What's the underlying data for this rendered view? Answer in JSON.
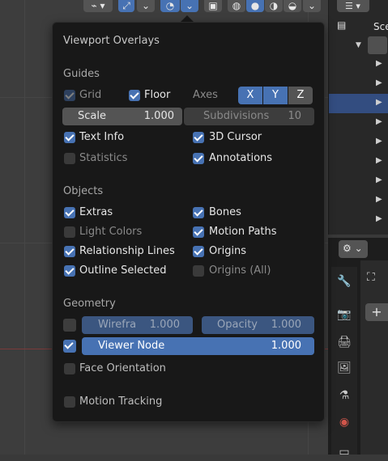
{
  "popover": {
    "title": "Viewport Overlays",
    "guides": {
      "heading": "Guides",
      "grid": {
        "label": "Grid",
        "checked": true,
        "enabled": false
      },
      "floor": {
        "label": "Floor",
        "checked": true
      },
      "axes_label": "Axes",
      "axes": [
        "X",
        "Y",
        "Z"
      ],
      "scale": {
        "label": "Scale",
        "value": "1.000"
      },
      "subdivisions": {
        "label": "Subdivisions",
        "value": "10"
      },
      "text_info": {
        "label": "Text Info",
        "checked": true
      },
      "cursor_3d": {
        "label": "3D Cursor",
        "checked": true
      },
      "statistics": {
        "label": "Statistics",
        "checked": false
      },
      "annotations": {
        "label": "Annotations",
        "checked": true
      }
    },
    "objects": {
      "heading": "Objects",
      "extras": {
        "label": "Extras",
        "checked": true
      },
      "bones": {
        "label": "Bones",
        "checked": true
      },
      "light_colors": {
        "label": "Light Colors",
        "checked": false
      },
      "motion_paths": {
        "label": "Motion Paths",
        "checked": true
      },
      "relationship_lines": {
        "label": "Relationship Lines",
        "checked": true
      },
      "origins": {
        "label": "Origins",
        "checked": true
      },
      "outline_selected": {
        "label": "Outline Selected",
        "checked": true
      },
      "origins_all": {
        "label": "Origins (All)",
        "checked": false
      }
    },
    "geometry": {
      "heading": "Geometry",
      "wireframe": {
        "label": "Wirefra",
        "value": "1.000",
        "checked": false
      },
      "opacity": {
        "label": "Opacity",
        "value": "1.000"
      },
      "viewer_node": {
        "label": "Viewer Node",
        "value": "1.000",
        "checked": true
      },
      "face_orientation": {
        "label": "Face Orientation",
        "checked": false
      },
      "motion_tracking": {
        "label": "Motion Tracking",
        "checked": false
      }
    }
  },
  "outliner": {
    "scene_label": "Sce"
  },
  "colors": {
    "accent": "#4772b3",
    "panel_bg": "#181818"
  }
}
